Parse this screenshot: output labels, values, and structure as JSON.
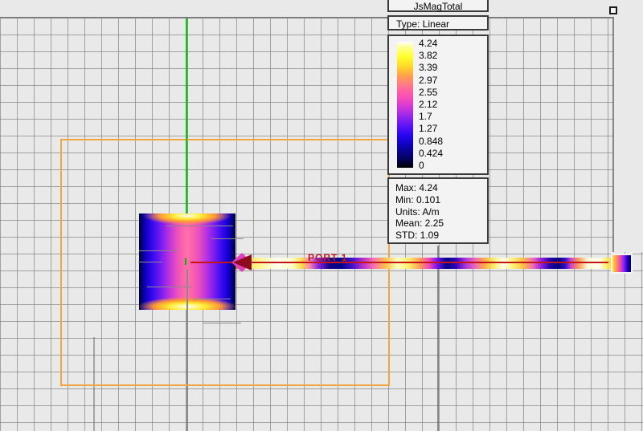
{
  "legend": {
    "title": "JsMagTotal",
    "type_label": "Type: Linear",
    "scale_values": [
      "4.24",
      "3.82",
      "3.39",
      "2.97",
      "2.55",
      "2.12",
      "1.7",
      "1.27",
      "0.848",
      "0.424",
      "0"
    ],
    "stats": {
      "max": "Max: 4.24",
      "min": "Min: 0.101",
      "units": "Units: A/m",
      "mean": "Mean: 2.25",
      "std": "STD: 1.09"
    }
  },
  "viewport": {
    "port_label": "PORT 1",
    "quantity": "JsMagTotal",
    "units": "A/m",
    "colormap_range": {
      "min": 0,
      "max": 4.24
    },
    "colors": {
      "substrate_outline": "#f2a43e",
      "axis_line": "#00d400",
      "feed_centerline": "#c41414",
      "port_label_text": "#c01828",
      "excitation_arrow": "#8e0a1e",
      "grid_line": "#8c8c8c",
      "background": "#e9e9e9",
      "colormap_top": "#ffffff",
      "colormap_bottom": "#000000"
    }
  }
}
